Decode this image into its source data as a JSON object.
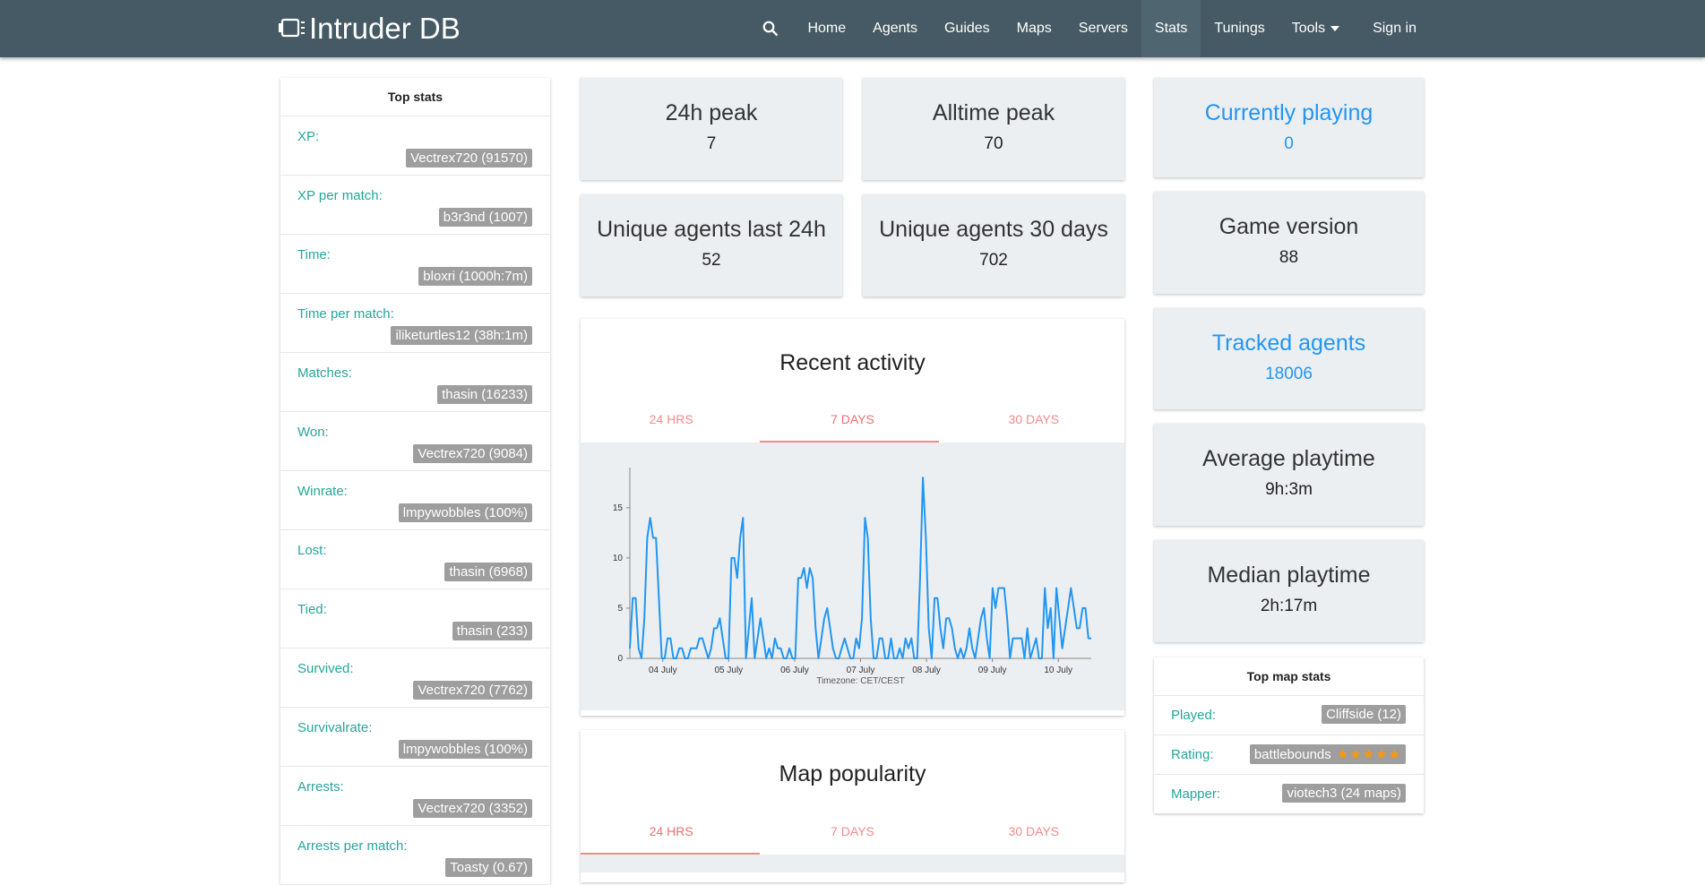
{
  "brand": {
    "name": "Intruder DB"
  },
  "nav": {
    "items": [
      "Home",
      "Agents",
      "Guides",
      "Maps",
      "Servers",
      "Stats",
      "Tunings",
      "Tools",
      "Sign in"
    ],
    "active": "Stats"
  },
  "top_stats": {
    "title": "Top stats",
    "rows": [
      {
        "label": "XP:",
        "value": "Vectrex720 (91570)"
      },
      {
        "label": "XP per match:",
        "value": "b3r3nd (1007)"
      },
      {
        "label": "Time:",
        "value": "bloxri (1000h:7m)"
      },
      {
        "label": "Time per match:",
        "value": "iliketurtles12 (38h:1m)"
      },
      {
        "label": "Matches:",
        "value": "thasin (16233)"
      },
      {
        "label": "Won:",
        "value": "Vectrex720 (9084)"
      },
      {
        "label": "Winrate:",
        "value": "lmpywobbles (100%)"
      },
      {
        "label": "Lost:",
        "value": "thasin (6968)"
      },
      {
        "label": "Tied:",
        "value": "thasin (233)"
      },
      {
        "label": "Survived:",
        "value": "Vectrex720 (7762)"
      },
      {
        "label": "Survivalrate:",
        "value": "lmpywobbles (100%)"
      },
      {
        "label": "Arrests:",
        "value": "Vectrex720 (3352)"
      },
      {
        "label": "Arrests per match:",
        "value": "Toasty (0.67)"
      }
    ]
  },
  "cards": {
    "peak24h": {
      "title": "24h peak",
      "value": "7"
    },
    "alltime": {
      "title": "Alltime peak",
      "value": "70"
    },
    "unique24": {
      "title": "Unique agents last 24h",
      "value": "52"
    },
    "unique30": {
      "title": "Unique agents 30 days",
      "value": "702"
    },
    "playing": {
      "title": "Currently playing",
      "value": "0"
    },
    "version": {
      "title": "Game version",
      "value": "88"
    },
    "tracked": {
      "title": "Tracked agents",
      "value": "18006"
    },
    "avg": {
      "title": "Average playtime",
      "value": "9h:3m"
    },
    "median": {
      "title": "Median playtime",
      "value": "2h:17m"
    }
  },
  "recent_activity": {
    "title": "Recent activity",
    "tabs": [
      "24 HRS",
      "7 DAYS",
      "30 DAYS"
    ],
    "active_tab": 1,
    "timezone": "Timezone: CET/CEST"
  },
  "map_popularity": {
    "title": "Map popularity",
    "tabs": [
      "24 HRS",
      "7 DAYS",
      "30 DAYS"
    ],
    "active_tab": 0
  },
  "top_map_stats": {
    "title": "Top map stats",
    "rows": [
      {
        "label": "Played:",
        "value": "Cliffside (12)"
      },
      {
        "label": "Rating:",
        "value": "battlebounds",
        "stars": 5
      },
      {
        "label": "Mapper:",
        "value": "viotech3 (24 maps)"
      }
    ]
  },
  "colors": {
    "nav": "#455a64",
    "accent": "#26a69a",
    "blue": "#2196f3",
    "line": "#2196f3",
    "tab": "#ee6e73"
  },
  "chart_data": {
    "type": "line",
    "x_tick_labels": [
      "04 July",
      "05 July",
      "06 July",
      "07 July",
      "08 July",
      "09 July",
      "10 July"
    ],
    "y_ticks": [
      0,
      5,
      10,
      15
    ],
    "ylim": [
      0,
      19
    ],
    "series": [
      {
        "values": [
          1,
          6,
          6,
          1,
          0,
          4,
          12,
          14,
          12,
          12,
          6,
          0,
          0,
          2,
          2,
          0,
          0,
          1,
          1,
          0,
          0,
          1,
          1,
          1,
          2,
          2,
          1,
          0,
          1,
          3,
          3,
          4,
          2,
          0,
          0,
          10,
          10,
          8,
          12,
          14,
          0,
          3,
          6,
          0,
          2,
          4,
          2,
          0,
          1,
          0,
          2,
          1,
          1,
          0,
          0,
          1,
          0,
          0,
          8,
          8,
          9,
          7,
          9,
          8,
          3,
          0,
          2,
          4,
          5,
          3,
          1,
          0,
          0,
          1,
          2,
          1,
          0,
          0,
          2,
          1,
          4,
          14,
          12,
          4,
          0,
          0,
          2,
          2,
          0,
          0,
          2,
          0,
          0,
          1,
          0,
          2,
          1,
          2,
          0,
          0,
          8,
          18,
          12,
          3,
          0,
          6,
          6,
          3,
          1,
          4,
          4,
          3,
          1,
          0,
          1,
          0,
          1,
          3,
          1,
          0,
          2,
          4,
          5,
          2,
          0,
          7,
          5,
          7,
          7,
          7,
          4,
          0,
          2,
          2,
          2,
          2,
          0,
          3,
          0,
          1,
          2,
          0,
          0,
          7,
          3,
          5,
          0,
          7,
          4,
          1,
          3,
          5,
          7,
          5,
          3,
          3,
          5,
          5,
          2,
          2
        ]
      }
    ]
  }
}
